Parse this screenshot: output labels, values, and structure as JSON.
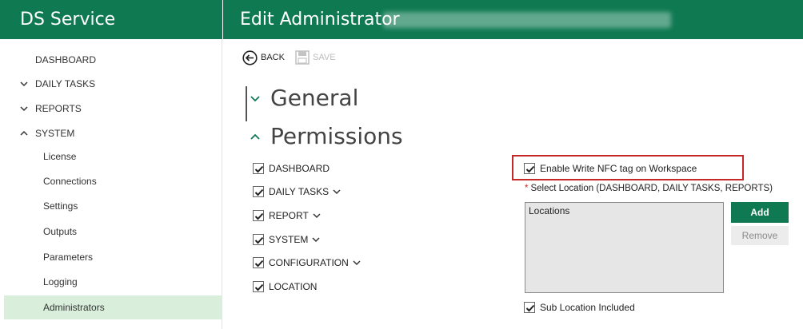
{
  "header": {
    "app_title": "DS Service",
    "page_title": "Edit Administrator"
  },
  "sidebar": {
    "items": [
      {
        "label": "DASHBOARD",
        "expandable": false
      },
      {
        "label": "DAILY TASKS",
        "expandable": true,
        "expanded": false
      },
      {
        "label": "REPORTS",
        "expandable": true,
        "expanded": false
      },
      {
        "label": "SYSTEM",
        "expandable": true,
        "expanded": true
      }
    ],
    "system_children": [
      {
        "label": "License"
      },
      {
        "label": "Connections"
      },
      {
        "label": "Settings"
      },
      {
        "label": "Outputs"
      },
      {
        "label": "Parameters"
      },
      {
        "label": "Logging"
      },
      {
        "label": "Administrators",
        "active": true
      }
    ]
  },
  "toolbar": {
    "back_label": "BACK",
    "save_label": "SAVE",
    "save_enabled": false
  },
  "sections": {
    "general_label": "General",
    "permissions_label": "Permissions"
  },
  "permissions": [
    {
      "label": "DASHBOARD",
      "checked": true,
      "has_dropdown": false
    },
    {
      "label": "DAILY TASKS",
      "checked": true,
      "has_dropdown": true
    },
    {
      "label": "REPORT",
      "checked": true,
      "has_dropdown": true
    },
    {
      "label": "SYSTEM",
      "checked": true,
      "has_dropdown": true
    },
    {
      "label": "CONFIGURATION",
      "checked": true,
      "has_dropdown": true
    },
    {
      "label": "LOCATION",
      "checked": true,
      "has_dropdown": false
    }
  ],
  "nfc": {
    "label": "Enable Write NFC tag on Workspace",
    "checked": true
  },
  "location": {
    "required_mark": "*",
    "select_label": "Select Location (DASHBOARD, DAILY TASKS, REPORTS)",
    "list_header": "Locations",
    "add_label": "Add",
    "remove_label": "Remove",
    "sub_location_label": "Sub Location Included",
    "sub_location_checked": true
  },
  "colors": {
    "brand": "#0f7a52",
    "active_nav": "#d9efdb",
    "highlight_border": "#c62828"
  }
}
